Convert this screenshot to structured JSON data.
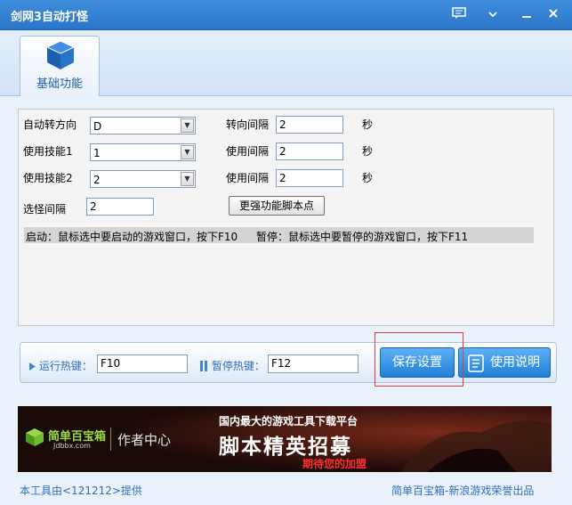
{
  "window": {
    "title": "剑网3自动打怪"
  },
  "tabs": [
    {
      "label": "基础功能"
    }
  ],
  "form": {
    "turn_direction": {
      "label": "自动转方向",
      "value": "D"
    },
    "turn_interval": {
      "label": "转向间隔",
      "value": "2",
      "unit": "秒"
    },
    "skill1": {
      "label": "使用技能1",
      "value": "1"
    },
    "skill1_interval": {
      "label": "使用间隔",
      "value": "2",
      "unit": "秒"
    },
    "skill2": {
      "label": "使用技能2",
      "value": "2"
    },
    "skill2_interval": {
      "label": "使用间隔",
      "value": "2",
      "unit": "秒"
    },
    "select_interval": {
      "label": "选怪间隔",
      "value": "2"
    },
    "script_points_button": "更强功能脚本点",
    "hint_start": "启动：鼠标选中要启动的游戏窗口，按下F10",
    "hint_pause": "暂停：鼠标选中要暂停的游戏窗口，按下F11"
  },
  "hotkeys": {
    "run_label": "运行热键：",
    "run_value": "F10",
    "pause_label": "暂停热键：",
    "pause_value": "F12",
    "save_button": "保存设置",
    "help_button": "使用说明"
  },
  "banner": {
    "brand": "简单百宝箱",
    "domain": "Jdbbx.com",
    "author_center": "作者中心",
    "headline": "国内最大的游戏工具下载平台",
    "recruit": "脚本精英招募",
    "tagline": "期待您的加盟"
  },
  "footer": {
    "left": "本工具由<121212>提供",
    "right": "简单百宝箱-新浪游戏荣誉出品"
  },
  "colors": {
    "titlebar": "#2a76c9",
    "accent": "#1f7fd6",
    "link": "#2e6fb7",
    "highlight": "#e03a3a"
  }
}
